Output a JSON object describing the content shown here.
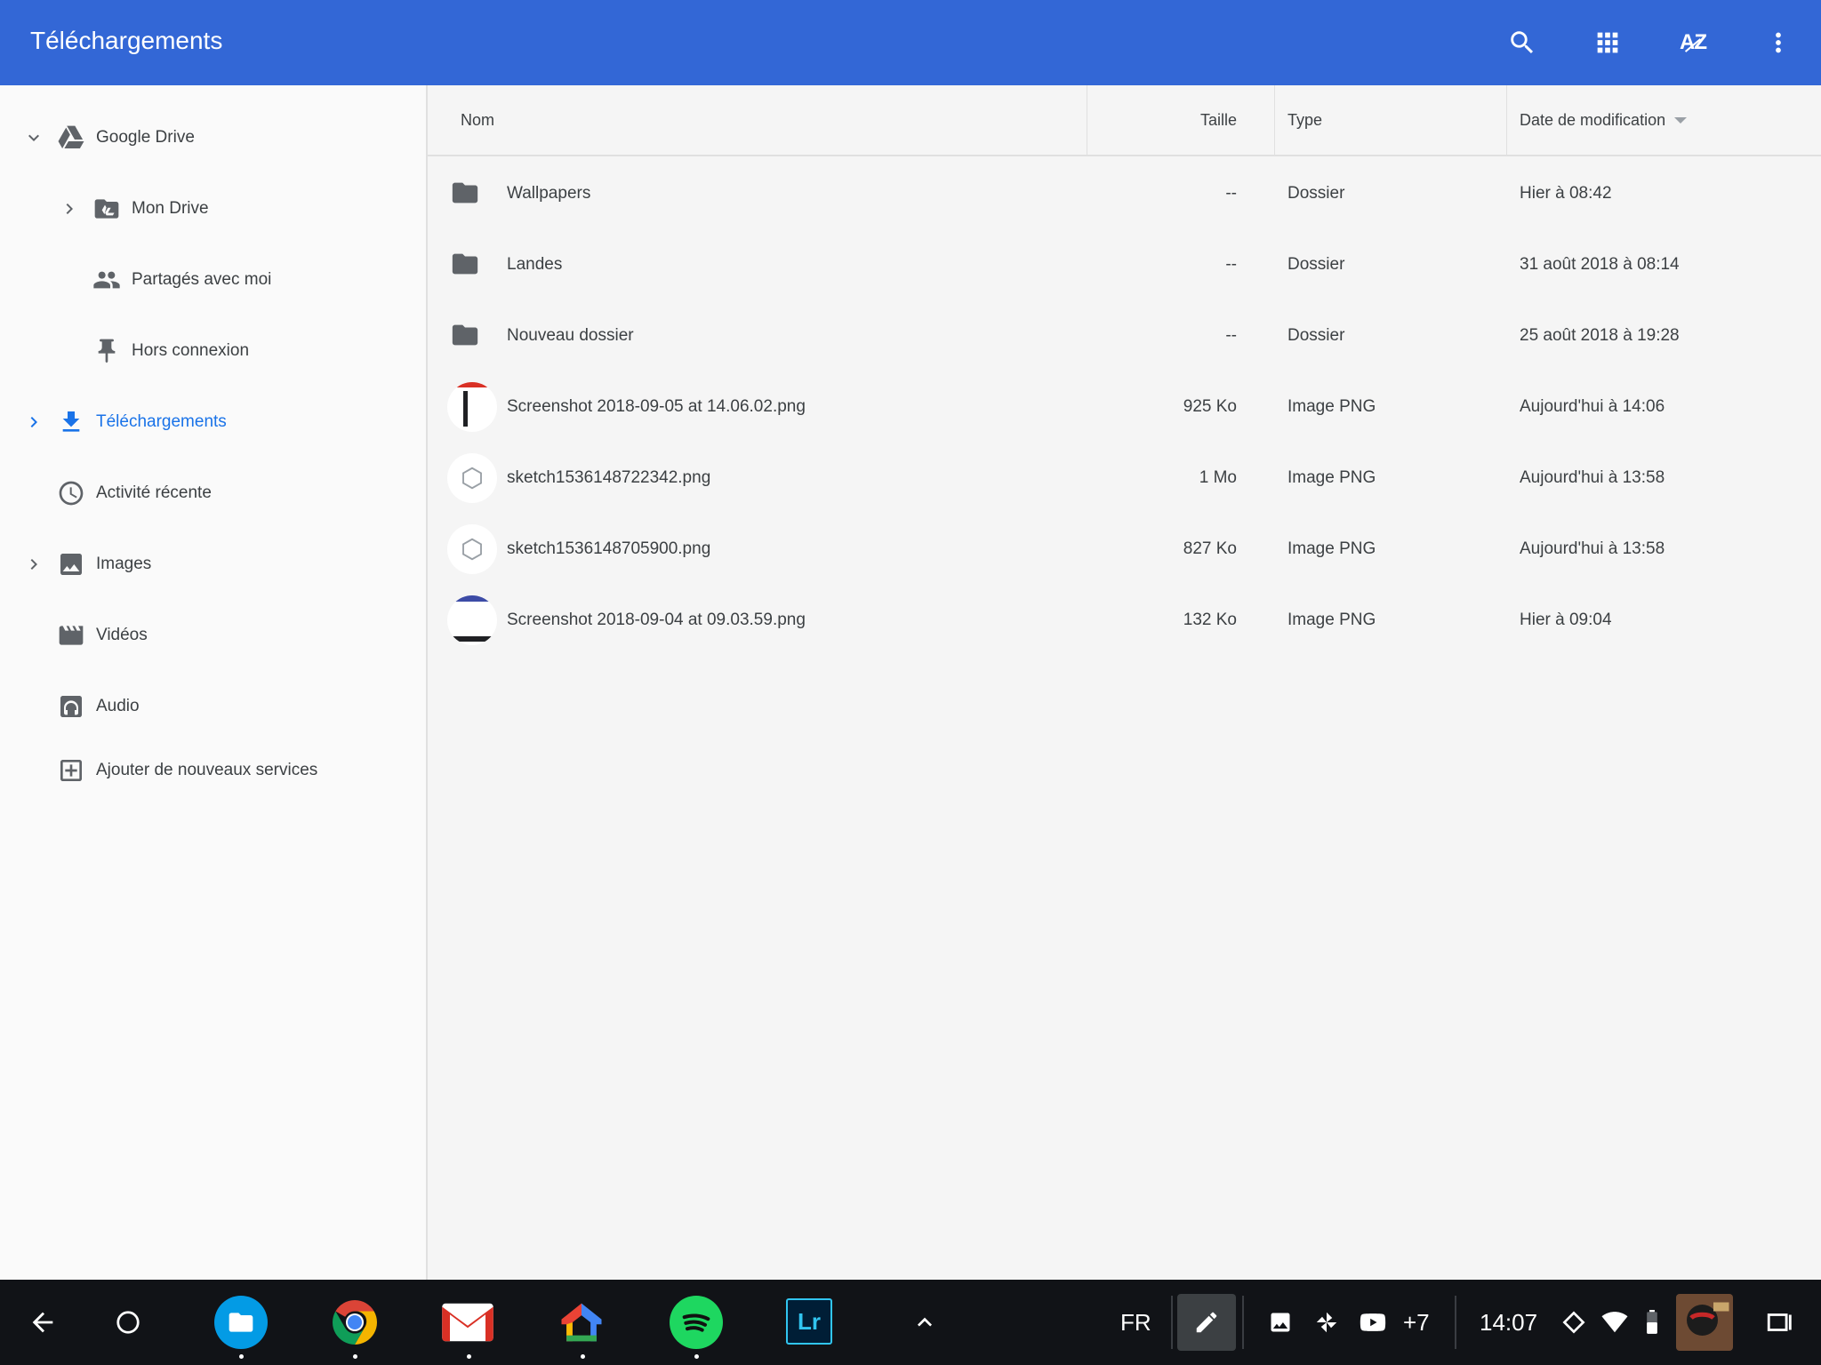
{
  "appbar": {
    "title": "Téléchargements",
    "sort_label": "AZ",
    "actions": [
      "search-icon",
      "grid-view-icon",
      "sort-az-icon",
      "more-vert-icon"
    ],
    "color": "#3367d6"
  },
  "sidebar": {
    "items": [
      {
        "label": "Google Drive",
        "icon": "google-drive-icon",
        "chevron": "expanded"
      },
      {
        "label": "Mon Drive",
        "icon": "my-drive-folder-icon",
        "chevron": "collapsed"
      },
      {
        "label": "Partagés avec moi",
        "icon": "people-icon"
      },
      {
        "label": "Hors connexion",
        "icon": "pin-icon"
      },
      {
        "label": "Téléchargements",
        "icon": "download-icon",
        "chevron": "collapsed",
        "active": true
      },
      {
        "label": "Activité récente",
        "icon": "clock-icon"
      },
      {
        "label": "Images",
        "icon": "image-icon",
        "chevron": "collapsed"
      },
      {
        "label": "Vidéos",
        "icon": "movie-icon"
      },
      {
        "label": "Audio",
        "icon": "headphones-icon"
      },
      {
        "label": "Ajouter de nouveaux services",
        "icon": "add-box-icon"
      }
    ],
    "active_color": "#1a73e8"
  },
  "list": {
    "columns": {
      "name": "Nom",
      "size": "Taille",
      "type": "Type",
      "date": "Date de modification"
    },
    "rows": [
      {
        "name": "Wallpapers",
        "size": "--",
        "type": "Dossier",
        "date": "Hier à 08:42",
        "icon": "folder-icon"
      },
      {
        "name": "Landes",
        "size": "--",
        "type": "Dossier",
        "date": "31 août 2018 à 08:14",
        "icon": "folder-icon"
      },
      {
        "name": "Nouveau dossier",
        "size": "--",
        "type": "Dossier",
        "date": "25 août 2018 à 19:28",
        "icon": "folder-icon"
      },
      {
        "name": "Screenshot 2018-09-05 at 14.06.02.png",
        "size": "925 Ko",
        "type": "Image PNG",
        "date": "Aujourd'hui à 14:06",
        "icon": "image-thumbnail"
      },
      {
        "name": "sketch1536148722342.png",
        "size": "1 Mo",
        "type": "Image PNG",
        "date": "Aujourd'hui à 13:58",
        "icon": "hexagon-thumbnail"
      },
      {
        "name": "sketch1536148705900.png",
        "size": "827 Ko",
        "type": "Image PNG",
        "date": "Aujourd'hui à 13:58",
        "icon": "hexagon-thumbnail"
      },
      {
        "name": "Screenshot 2018-09-04 at 09.03.59.png",
        "size": "132 Ko",
        "type": "Image PNG",
        "date": "Hier à 09:04",
        "icon": "image-thumbnail"
      }
    ]
  },
  "shelf": {
    "apps": [
      "files-app-icon",
      "chrome-app-icon",
      "gmail-app-icon",
      "google-home-app-icon",
      "spotify-app-icon",
      "lightroom-app-icon"
    ],
    "lightroom_label": "Lr",
    "tray": {
      "ime": "FR",
      "notification_count": "+7",
      "time": "14:07"
    }
  }
}
